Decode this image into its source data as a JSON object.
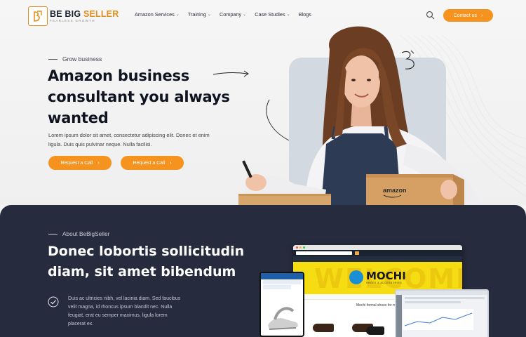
{
  "brand": {
    "name_main": "BE BIG ",
    "name_accent": "SELLER",
    "tagline": "FEARLESS GROWTH"
  },
  "nav": {
    "items": [
      {
        "label": "Amazon Services",
        "has_dropdown": true
      },
      {
        "label": "Training",
        "has_dropdown": true
      },
      {
        "label": "Company",
        "has_dropdown": true
      },
      {
        "label": "Case Studies",
        "has_dropdown": true
      },
      {
        "label": "Blogs",
        "has_dropdown": false
      }
    ],
    "contact_label": "Contact us",
    "contact_arrow": "›"
  },
  "hero": {
    "eyebrow": "Grow business",
    "title": "Amazon business consultant you always wanted",
    "description": "Lorem ipsum dolor sit amet, consectetur adipiscing elit. Donec et enim ligula. Duis quis pulvinar neque. Nulla facilisi.",
    "cta_primary": "Request a Call",
    "cta_secondary": "Request a Call",
    "cta_arrow": "›",
    "box_label": "amazon"
  },
  "about": {
    "eyebrow": "About BeBigSeller",
    "title": "Donec lobortis sollicitudin diam, sit amet bibendum",
    "description": "Duis ac ultricies nibh, vel lacinia diam. Sed faucibus velit magna, id rhoncus ipsum blandit nec. Nulla feugiat, erat eu semper maximus, ligula lorem placerat ex.",
    "mockup": {
      "banner_ghost": "WELCOME",
      "brand_name": "MOCHI",
      "brand_tag": "SHOES & ACCESSORIES",
      "shop_heading": "Mochi formal shoes for men"
    }
  },
  "colors": {
    "accent": "#f5931e",
    "dark": "#262b3d",
    "title": "#101320"
  }
}
